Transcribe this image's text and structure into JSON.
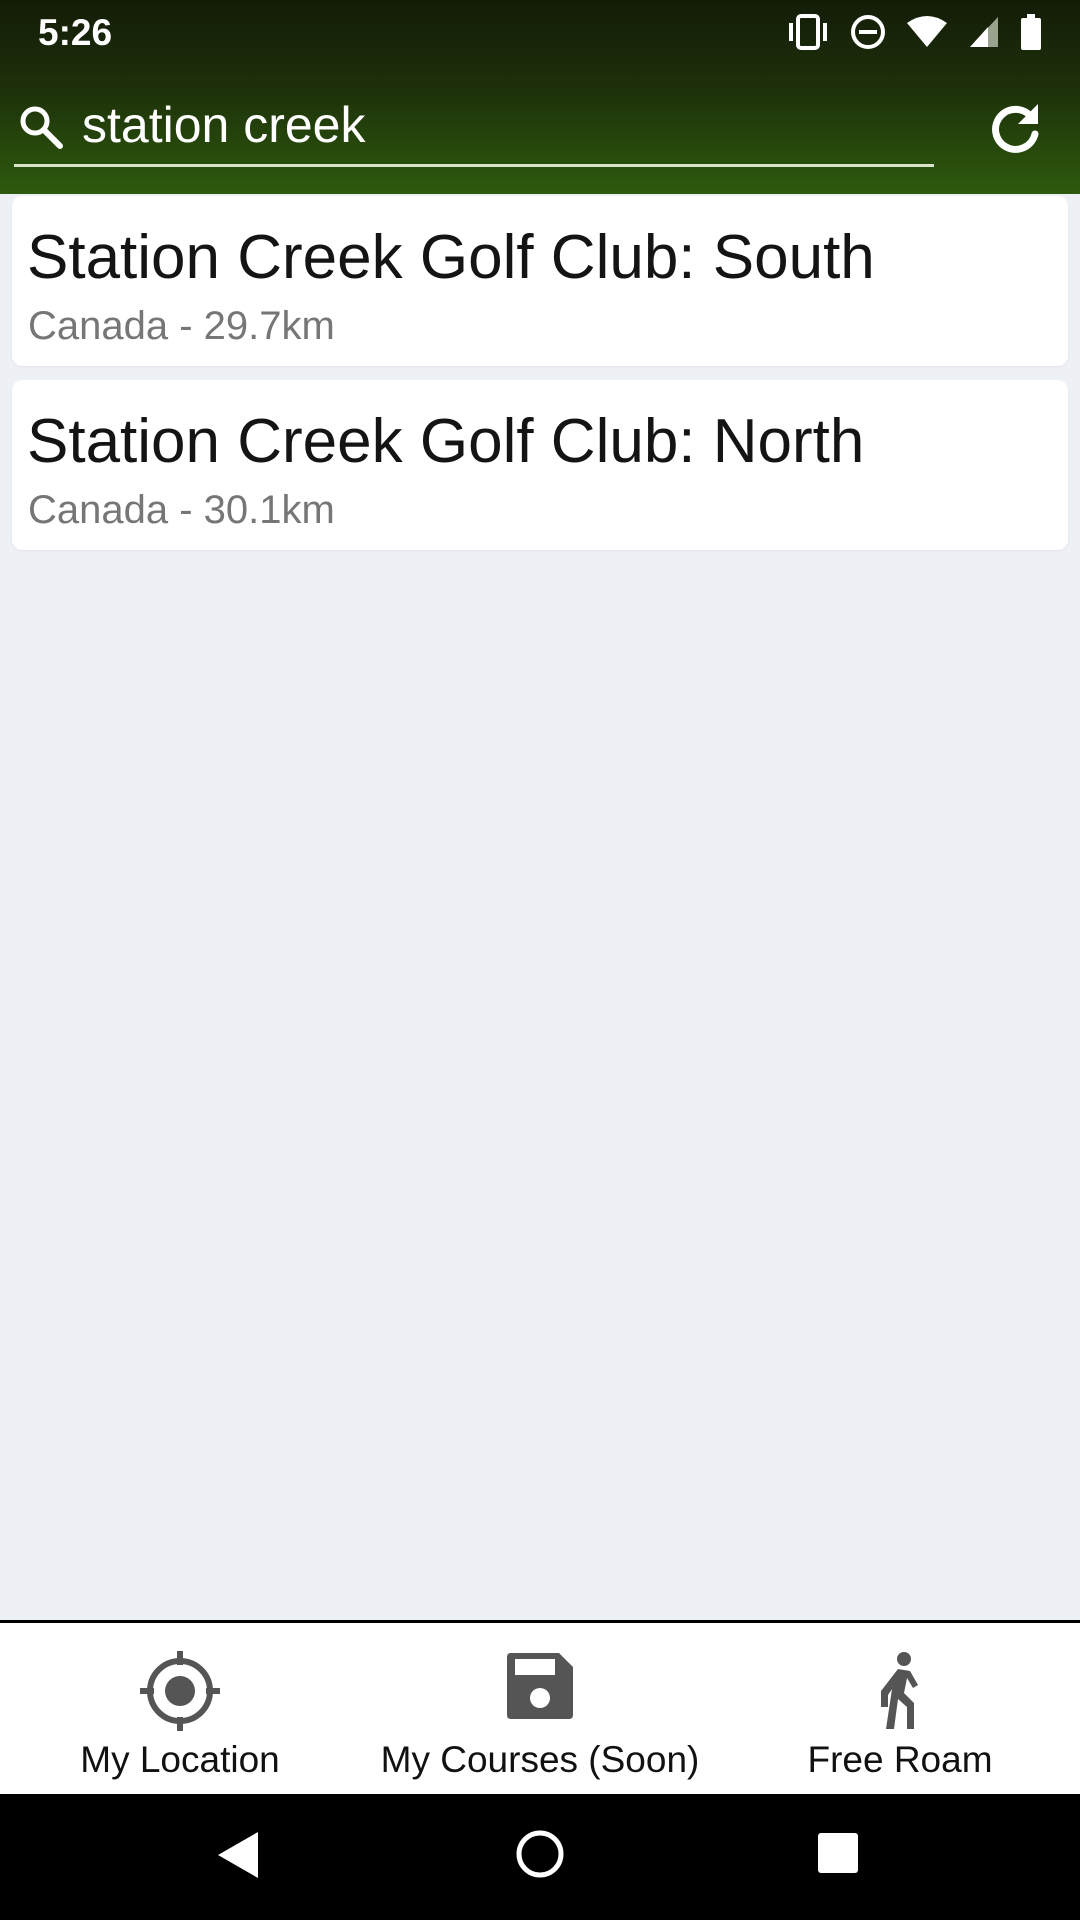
{
  "status_bar": {
    "time": "5:26",
    "icons": [
      "vibrate-icon",
      "do-not-disturb-icon",
      "wifi-icon",
      "cell-signal-icon",
      "battery-icon"
    ]
  },
  "search": {
    "value": "station creek",
    "placeholder": ""
  },
  "results": [
    {
      "title": "Station Creek Golf Club: South",
      "subtitle": "Canada - 29.7km"
    },
    {
      "title": "Station Creek Golf Club: North",
      "subtitle": "Canada - 30.1km"
    }
  ],
  "bottom_nav": {
    "items": [
      {
        "label": "My Location",
        "icon": "my-location-icon"
      },
      {
        "label": "My Courses (Soon)",
        "icon": "save-icon"
      },
      {
        "label": "Free Roam",
        "icon": "walking-person-icon"
      }
    ]
  },
  "system_nav": [
    "back-icon",
    "home-icon",
    "recents-icon"
  ],
  "colors": {
    "header_top": "#141c08",
    "header_bottom": "#2e5a0d",
    "background": "#edf1f5",
    "card": "#ffffff",
    "subtitle": "#767676",
    "nav_icon": "#555555"
  }
}
